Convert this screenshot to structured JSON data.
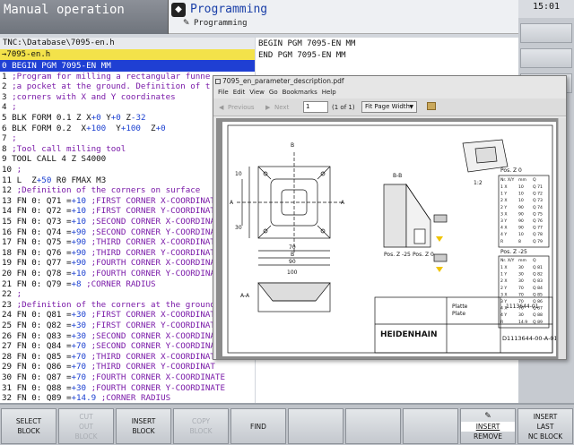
{
  "header": {
    "mode_title": "Manual operation",
    "prog_title": "Programming",
    "prog_sub": "Programming",
    "clock": "15:01"
  },
  "editor": {
    "path": "TNC:\\Database\\7095-en.h",
    "file": "→7095-en.h",
    "lines": [
      {
        "n": "0",
        "text": "BEGIN PGM 7095-EN MM",
        "type": "plain",
        "selected": true
      },
      {
        "n": "1",
        "text": ";Program for milling a rectangular funne",
        "type": "comment"
      },
      {
        "n": "2",
        "text": ";a pocket at the ground. Definition of t",
        "type": "comment"
      },
      {
        "n": "3",
        "text": ";corners with X and Y coordinates",
        "type": "comment"
      },
      {
        "n": "4",
        "text": ";",
        "type": "comment"
      },
      {
        "n": "5",
        "text": "BLK FORM 0.1 Z X+0 Y+0 Z-32",
        "type": "blk1"
      },
      {
        "n": "6",
        "text": "BLK FORM 0.2  X+100  Y+100  Z+0",
        "type": "blk2"
      },
      {
        "n": "7",
        "text": ";",
        "type": "comment"
      },
      {
        "n": "8",
        "text": ";Tool call milling tool",
        "type": "comment"
      },
      {
        "n": "9",
        "text": "TOOL CALL 4 Z S4000",
        "type": "tool"
      },
      {
        "n": "10",
        "text": ";",
        "type": "comment"
      },
      {
        "n": "11",
        "text": "L  Z+50 R0 FMAX M3",
        "type": "l"
      },
      {
        "n": "12",
        "text": ";Definition of the corners on surface",
        "type": "comment"
      },
      {
        "n": "13",
        "text": "FN 0: Q71 =+10 ;FIRST CORNER X-COORDINAT",
        "type": "fn"
      },
      {
        "n": "14",
        "text": "FN 0: Q72 =+10 ;FIRST CORNER Y-COORDINAT",
        "type": "fn"
      },
      {
        "n": "15",
        "text": "FN 0: Q73 =+10 ;SECOND CORNER X-COORDINA",
        "type": "fn"
      },
      {
        "n": "16",
        "text": "FN 0: Q74 =+90 ;SECOND CORNER Y-COORDINA",
        "type": "fn"
      },
      {
        "n": "17",
        "text": "FN 0: Q75 =+90 ;THIRD CORNER X-COORDINAT",
        "type": "fn"
      },
      {
        "n": "18",
        "text": "FN 0: Q76 =+90 ;THIRD CORNER Y-COORDINAT",
        "type": "fn"
      },
      {
        "n": "19",
        "text": "FN 0: Q77 =+90 ;FOURTH CORNER X-COORDINAT",
        "type": "fn"
      },
      {
        "n": "20",
        "text": "FN 0: Q78 =+10 ;FOURTH CORNER Y-COORDINAT",
        "type": "fn"
      },
      {
        "n": "21",
        "text": "FN 0: Q79 =+8 ;CORNER RADIUS",
        "type": "fn"
      },
      {
        "n": "22",
        "text": ";",
        "type": "comment"
      },
      {
        "n": "23",
        "text": ";Definition of the corners at the ground",
        "type": "comment"
      },
      {
        "n": "24",
        "text": "FN 0: Q81 =+30 ;FIRST CORNER X-COORDINAT",
        "type": "fn"
      },
      {
        "n": "25",
        "text": "FN 0: Q82 =+30 ;FIRST CORNER Y-COORDINAT",
        "type": "fn"
      },
      {
        "n": "26",
        "text": "FN 0: Q83 =+30 ;SECOND CORNER X-COORDINA",
        "type": "fn"
      },
      {
        "n": "27",
        "text": "FN 0: Q84 =+70 ;SECOND CORNER Y-COORDINA",
        "type": "fn"
      },
      {
        "n": "28",
        "text": "FN 0: Q85 =+70 ;THIRD CORNER X-COORDINAT",
        "type": "fn"
      },
      {
        "n": "29",
        "text": "FN 0: Q86 =+70 ;THIRD CORNER Y-COORDINAT",
        "type": "fn"
      },
      {
        "n": "30",
        "text": "FN 0: Q87 =+70 ;FOURTH CORNER X-COORDINATE",
        "type": "fn"
      },
      {
        "n": "31",
        "text": "FN 0: Q88 =+30 ;FOURTH CORNER Y-COORDINATE",
        "type": "fn"
      },
      {
        "n": "32",
        "text": "FN 0: Q89 =+14.9 ;CORNER RADIUS",
        "type": "fn"
      }
    ]
  },
  "second_program": {
    "lines": [
      "BEGIN PGM 7095-EN MM",
      "END PGM 7095-EN MM"
    ]
  },
  "pdf_viewer": {
    "title": "7095_en_parameter_description.pdf",
    "menu": [
      "File",
      "Edit",
      "View",
      "Go",
      "Bookmarks",
      "Help"
    ],
    "previous": "Previous",
    "next": "Next",
    "page_value": "1",
    "page_of": "(1 of 1)",
    "zoom": "Fit Page Width",
    "drawing": {
      "section_bb": "B-B",
      "section_aa": "A-A",
      "label_b": "B",
      "label_a": "A",
      "label_12": "1:2",
      "pos_z0": "Pos. Z 0",
      "pos_z25": "Pos. Z -25",
      "pos_z25_b": "Pos. Z -25",
      "pos_z0_b": "Pos. Z 0",
      "brand": "HEIDENHAIN",
      "part_no": "D1113644-00-A-01",
      "plate": "Platte",
      "plate_en": "Plate",
      "dim_100": "100",
      "dim_90": "90",
      "dim_70": "70",
      "dim_30": "30",
      "dim_10": "10",
      "rev": "1113644-01"
    },
    "table1": {
      "head": [
        "Nr. X/Y",
        "mm",
        "Q"
      ],
      "rows": [
        [
          "1 X",
          "10",
          "Q 71"
        ],
        [
          "1 Y",
          "10",
          "Q 72"
        ],
        [
          "2 X",
          "10",
          "Q 73"
        ],
        [
          "2 Y",
          "90",
          "Q 74"
        ],
        [
          "3 X",
          "90",
          "Q 75"
        ],
        [
          "3 Y",
          "90",
          "Q 76"
        ],
        [
          "4 X",
          "90",
          "Q 77"
        ],
        [
          "4 Y",
          "10",
          "Q 78"
        ],
        [
          "R",
          "8",
          "Q 79"
        ]
      ]
    },
    "table2": {
      "head": [
        "Nr. X/Y",
        "mm",
        "Q"
      ],
      "rows": [
        [
          "1 X",
          "30",
          "Q 81"
        ],
        [
          "1 Y",
          "30",
          "Q 82"
        ],
        [
          "2 X",
          "30",
          "Q 83"
        ],
        [
          "2 Y",
          "70",
          "Q 84"
        ],
        [
          "3 X",
          "70",
          "Q 85"
        ],
        [
          "3 Y",
          "70",
          "Q 86"
        ],
        [
          "4 X",
          "70",
          "Q 87"
        ],
        [
          "4 Y",
          "30",
          "Q 88"
        ],
        [
          "R",
          "14.9",
          "Q 89"
        ]
      ]
    }
  },
  "softkeys": [
    {
      "label1": "SELECT",
      "label2": "BLOCK",
      "enabled": true
    },
    {
      "label1": "CUT",
      "label2": "OUT",
      "label3": "BLOCK",
      "enabled": false
    },
    {
      "label1": "INSERT",
      "label2": "BLOCK",
      "enabled": true
    },
    {
      "label1": "COPY",
      "label2": "BLOCK",
      "enabled": false
    },
    {
      "label1": "FIND",
      "enabled": true
    },
    {
      "label1": "",
      "enabled": true
    },
    {
      "label1": "",
      "enabled": true
    },
    {
      "label1": "",
      "enabled": true
    },
    {
      "label1": "INSERT",
      "label2": "REMOVE",
      "enabled": true,
      "pen": true
    },
    {
      "label1": "INSERT",
      "label2": "LAST",
      "label3": "NC BLOCK",
      "enabled": true
    }
  ]
}
